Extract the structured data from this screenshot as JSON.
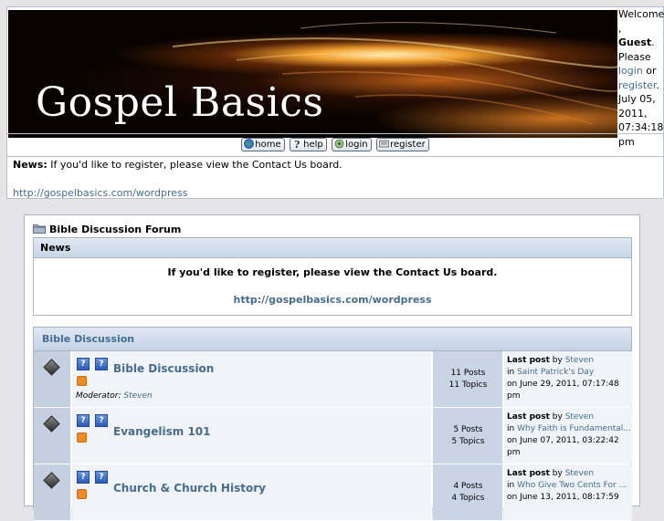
{
  "header": {
    "banner_title": "Gospel Basics",
    "welcome": {
      "line1": "Welcome,",
      "guest": "Guest",
      "please": "Please",
      "login": "login",
      "or": "or",
      "register": "register",
      "date": "July 05, 2011, 07:34:18 pm"
    },
    "menu": [
      {
        "label": "home",
        "icon": "globe-icon"
      },
      {
        "label": "help",
        "icon": "question-icon"
      },
      {
        "label": "login",
        "icon": "login-icon"
      },
      {
        "label": "register",
        "icon": "register-icon"
      }
    ],
    "news_label": "News:",
    "news_text": "If you'd like to register, please view the Contact Us board.",
    "news_url": "http://gospelbasics.com/wordpress"
  },
  "forum": {
    "breadcrumb": "Bible Discussion Forum",
    "news": {
      "title": "News",
      "message": "If you'd like to register, please view the Contact Us board.",
      "url": "http://gospelbasics.com/wordpress"
    },
    "category": {
      "title": "Bible Discussion",
      "boards": [
        {
          "name": "Bible Discussion",
          "moderator_label": "Moderator:",
          "moderator": "Steven",
          "posts": "11 Posts",
          "topics": "11 Topics",
          "last_post_label": "Last post",
          "by": "by",
          "last_user": "Steven",
          "in": "in",
          "last_topic": "Saint Patrick's Day",
          "last_date": "on June 29, 2011, 07:17:48",
          "last_time_suffix": "pm"
        },
        {
          "name": "Evangelism 101",
          "posts": "5 Posts",
          "topics": "5 Topics",
          "last_post_label": "Last post",
          "by": "by",
          "last_user": "Steven",
          "in": "in",
          "last_topic": "Why Faith is Fundamental...",
          "last_date": "on June 07, 2011, 03:22:42",
          "last_time_suffix": "pm"
        },
        {
          "name": "Church & Church History",
          "posts": "4 Posts",
          "topics": "4 Topics",
          "last_post_label": "Last post",
          "by": "by",
          "last_user": "Steven",
          "in": "in",
          "last_topic": "Who Give Two Cents For ...",
          "last_date": "on June 13, 2011, 08:17:59"
        }
      ]
    }
  },
  "colors": {
    "link": "#476c8e",
    "page_bg": "#e5e5e8",
    "title_bar": "#c7d5e6",
    "stats_bg": "#c9d5e4"
  }
}
